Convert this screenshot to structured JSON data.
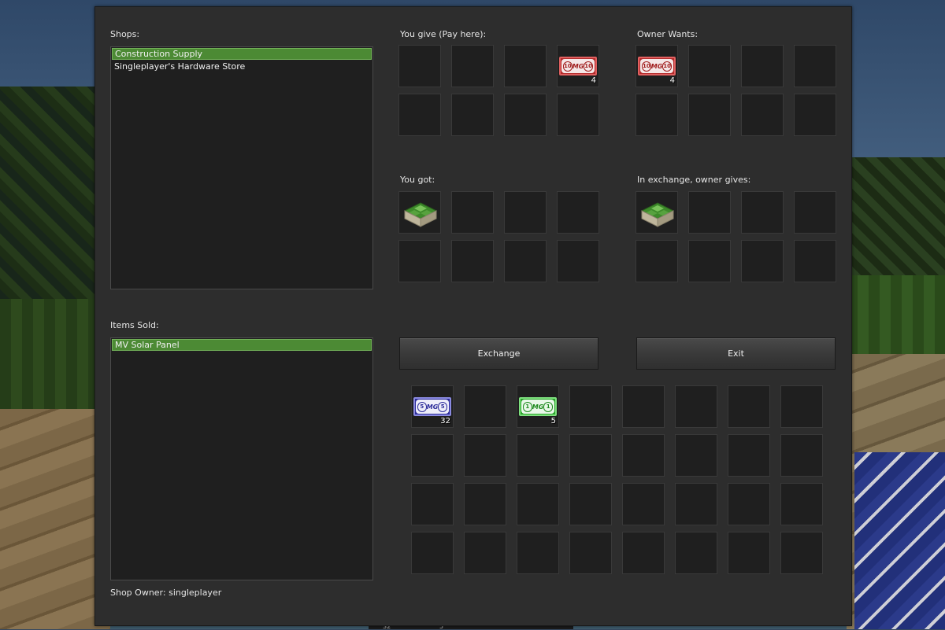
{
  "shops": {
    "label": "Shops:",
    "items": [
      "Construction Supply",
      "Singleplayer's Hardware Store"
    ],
    "selected_index": 0
  },
  "items_sold": {
    "label": "Items Sold:",
    "items": [
      "MV Solar Panel"
    ],
    "selected_index": 0
  },
  "shop_owner": "Shop Owner: singleplayer",
  "you_give": {
    "label": "You give (Pay here):",
    "slots": [
      null,
      null,
      null,
      {
        "item": "10 MG note",
        "icon": "money-note-10-icon",
        "color": "red",
        "value": "10",
        "count": "4"
      },
      null,
      null,
      null,
      null
    ]
  },
  "owner_wants": {
    "label": "Owner Wants:",
    "slots": [
      {
        "item": "10 MG note",
        "icon": "money-note-10-icon",
        "color": "red",
        "value": "10",
        "count": "4"
      },
      null,
      null,
      null,
      null,
      null,
      null,
      null
    ]
  },
  "you_got": {
    "label": "You got:",
    "slots": [
      {
        "item": "MV Solar Panel",
        "icon": "solar-panel-icon",
        "count": ""
      },
      null,
      null,
      null,
      null,
      null,
      null,
      null
    ]
  },
  "owner_gives": {
    "label": "In exchange, owner gives:",
    "slots": [
      {
        "item": "MV Solar Panel",
        "icon": "solar-panel-icon",
        "count": ""
      },
      null,
      null,
      null,
      null,
      null,
      null,
      null
    ]
  },
  "buttons": {
    "exchange": "Exchange",
    "exit": "Exit"
  },
  "inventory": {
    "slots": [
      {
        "item": "5 MG note",
        "icon": "money-note-5-icon",
        "color": "blue",
        "value": "5",
        "count": "32"
      },
      null,
      {
        "item": "1 MG note",
        "icon": "money-note-1-icon",
        "color": "green",
        "value": "1",
        "count": "5"
      },
      null,
      null,
      null,
      null,
      null,
      null,
      null,
      null,
      null,
      null,
      null,
      null,
      null,
      null,
      null,
      null,
      null,
      null,
      null,
      null,
      null,
      null,
      null,
      null,
      null,
      null,
      null,
      null,
      null
    ]
  },
  "note_text": "MG",
  "hotbar": [
    "32",
    "5"
  ],
  "colors": {
    "panel": "#2d2d2d",
    "slot": "#1f1f1f",
    "selected": "#4c8a34",
    "note_red": "#b42a2a",
    "note_blue": "#2c2c9a",
    "note_green": "#2aa42a"
  }
}
